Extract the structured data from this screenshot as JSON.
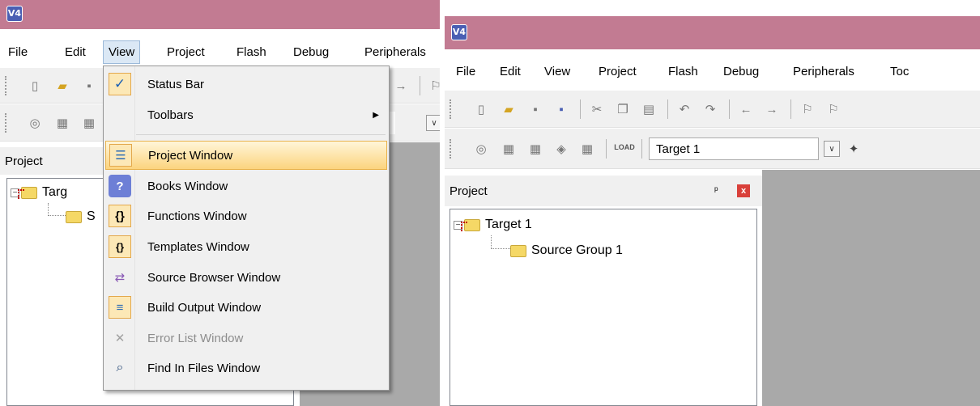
{
  "left": {
    "menubar": [
      {
        "label": "File"
      },
      {
        "label": "Edit"
      },
      {
        "label": "View"
      },
      {
        "label": "Project"
      },
      {
        "label": "Flash"
      },
      {
        "label": "Debug"
      },
      {
        "label": "Peripherals"
      }
    ],
    "project_header": "Project",
    "tree": {
      "target": "Targ",
      "group": "S"
    },
    "view_menu": {
      "items": [
        {
          "label": "Status Bar",
          "icon": "check-icon"
        },
        {
          "label": "Toolbars",
          "icon": "none"
        },
        {
          "label": "Project Window",
          "icon": "project-window-icon"
        },
        {
          "label": "Books Window",
          "icon": "books-icon"
        },
        {
          "label": "Functions Window",
          "icon": "functions-icon"
        },
        {
          "label": "Templates Window",
          "icon": "templates-icon"
        },
        {
          "label": "Source Browser Window",
          "icon": "source-browser-icon"
        },
        {
          "label": "Build Output Window",
          "icon": "build-output-icon"
        },
        {
          "label": "Error List Window",
          "icon": "error-list-icon"
        },
        {
          "label": "Find In Files Window",
          "icon": "find-in-files-icon"
        }
      ]
    }
  },
  "right": {
    "menubar": [
      {
        "label": "File"
      },
      {
        "label": "Edit"
      },
      {
        "label": "View"
      },
      {
        "label": "Project"
      },
      {
        "label": "Flash"
      },
      {
        "label": "Debug"
      },
      {
        "label": "Peripherals"
      },
      {
        "label": "Toc"
      }
    ],
    "target_select": "Target 1",
    "project_header": "Project",
    "tree": {
      "target": "Target 1",
      "group": "Source Group 1"
    }
  },
  "icons": {
    "check": "✓",
    "submenu": "▶",
    "pin": "ᵖ",
    "close": "x",
    "combo": "∨",
    "project_window": "☰",
    "books": "?",
    "functions": "{}",
    "templates": "{}",
    "source_browser": "⇄",
    "build_output": "≡",
    "error_list": "✕",
    "find_in_files": "⌕",
    "app": "V4"
  },
  "colors": {
    "titlebar": "#c27b92",
    "highlight": "#fcd47e",
    "workspace": "#a9a9a9"
  }
}
